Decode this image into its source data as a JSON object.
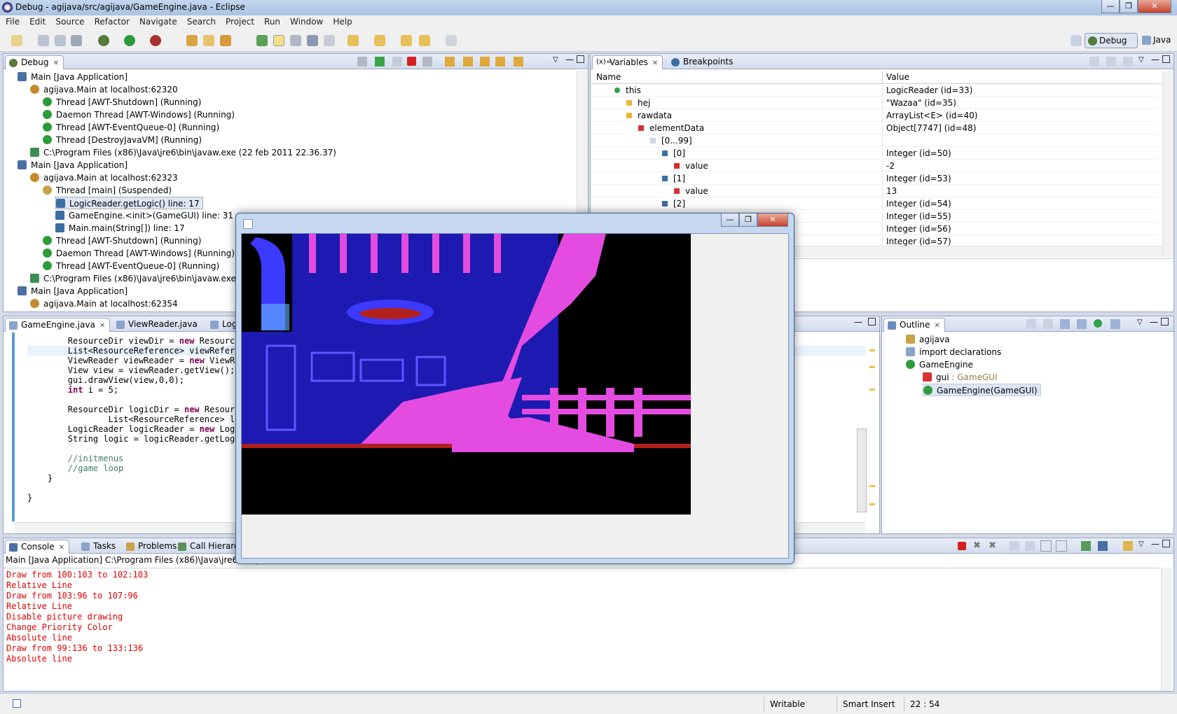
{
  "window": {
    "title": "Debug - agijava/src/agijava/GameEngine.java - Eclipse"
  },
  "menu": [
    "File",
    "Edit",
    "Source",
    "Refactor",
    "Navigate",
    "Search",
    "Project",
    "Run",
    "Window",
    "Help"
  ],
  "perspectives": {
    "debug": "Debug",
    "java": "Java"
  },
  "debug_view": {
    "tab": "Debug",
    "rows": [
      {
        "text": "Main [Java Application]",
        "indent": 0,
        "icon": "launch-icon"
      },
      {
        "text": "agijava.Main at localhost:62320",
        "indent": 1,
        "icon": "debug-target-icon"
      },
      {
        "text": "Thread [AWT-Shutdown] (Running)",
        "indent": 2,
        "icon": "thread-icon"
      },
      {
        "text": "Daemon Thread [AWT-Windows] (Running)",
        "indent": 2,
        "icon": "thread-icon"
      },
      {
        "text": "Thread [AWT-EventQueue-0] (Running)",
        "indent": 2,
        "icon": "thread-icon"
      },
      {
        "text": "Thread [DestroyJavaVM] (Running)",
        "indent": 2,
        "icon": "thread-icon"
      },
      {
        "text": "C:\\Program Files (x86)\\Java\\jre6\\bin\\javaw.exe (22 feb 2011 22.36.37)",
        "indent": 1,
        "icon": "process-icon"
      },
      {
        "text": "Main [Java Application]",
        "indent": 0,
        "icon": "launch-icon"
      },
      {
        "text": "agijava.Main at localhost:62323",
        "indent": 1,
        "icon": "debug-target-icon"
      },
      {
        "text": "Thread [main] (Suspended)",
        "indent": 2,
        "icon": "suspended-thread-icon"
      },
      {
        "text": "LogicReader.getLogic() line: 17",
        "indent": 3,
        "icon": "stack-frame-icon",
        "selected": true
      },
      {
        "text": "GameEngine.<init>(GameGUI) line: 31",
        "indent": 3,
        "icon": "stack-frame-icon"
      },
      {
        "text": "Main.main(String[]) line: 17",
        "indent": 3,
        "icon": "stack-frame-icon"
      },
      {
        "text": "Thread [AWT-Shutdown] (Running)",
        "indent": 2,
        "icon": "thread-icon"
      },
      {
        "text": "Daemon Thread [AWT-Windows] (Running)",
        "indent": 2,
        "icon": "thread-icon"
      },
      {
        "text": "Thread [AWT-EventQueue-0] (Running)",
        "indent": 2,
        "icon": "thread-icon"
      },
      {
        "text": "C:\\Program Files (x86)\\Java\\jre6\\bin\\javaw.exe (22",
        "indent": 1,
        "icon": "process-icon"
      },
      {
        "text": "Main [Java Application]",
        "indent": 0,
        "icon": "launch-icon"
      },
      {
        "text": "agijava.Main at localhost:62354",
        "indent": 1,
        "icon": "debug-target-icon"
      }
    ]
  },
  "variables_view": {
    "tabs": [
      "Variables",
      "Breakpoints"
    ],
    "columns": [
      "Name",
      "Value"
    ],
    "rows": [
      {
        "name": "this",
        "value": "LogicReader  (id=33)",
        "indent": 0
      },
      {
        "name": "hej",
        "value": "\"Wazaa\" (id=35)",
        "indent": 1
      },
      {
        "name": "rawdata",
        "value": "ArrayList<E>  (id=40)",
        "indent": 1
      },
      {
        "name": "elementData",
        "value": "Object[7747]  (id=48)",
        "indent": 2
      },
      {
        "name": "[0...99]",
        "value": "",
        "indent": 3
      },
      {
        "name": "[0]",
        "value": "Integer  (id=50)",
        "indent": 4
      },
      {
        "name": "value",
        "value": "-2",
        "indent": 5
      },
      {
        "name": "[1]",
        "value": "Integer  (id=53)",
        "indent": 4
      },
      {
        "name": "value",
        "value": "13",
        "indent": 5
      },
      {
        "name": "[2]",
        "value": "Integer  (id=54)",
        "indent": 4
      },
      {
        "name": "",
        "value": "Integer  (id=55)",
        "indent": 4
      },
      {
        "name": "",
        "value": "Integer  (id=56)",
        "indent": 4
      },
      {
        "name": "",
        "value": "Integer  (id=57)",
        "indent": 4
      }
    ]
  },
  "editor": {
    "tabs": [
      "GameEngine.java",
      "ViewReader.java",
      "Log"
    ],
    "lines": [
      "        ResourceDir viewDir = new ResourceD",
      "        List<ResourceReference> viewRefere",
      "        ViewReader viewReader = new ViewRea",
      "        View view = viewReader.getView();",
      "        gui.drawView(view,0,0);",
      "        int i = 5;",
      "",
      "        ResourceDir logicDir = new Resource",
      "                List<ResourceReference> log",
      "        LogicReader logicReader = new Logic",
      "        String logic = logicReader.getLogic",
      "",
      "        //initmenus",
      "        //game loop",
      "    }",
      "",
      "}"
    ]
  },
  "outline_view": {
    "tab": "Outline",
    "rows": [
      {
        "text": "agijava",
        "extra": "",
        "indent": 0,
        "icon": "package-icon"
      },
      {
        "text": "import declarations",
        "extra": "",
        "indent": 0,
        "icon": "imports-icon"
      },
      {
        "text": "GameEngine",
        "extra": "",
        "indent": 0,
        "icon": "class-icon"
      },
      {
        "text": "gui",
        "extra": " : GameGUI",
        "indent": 1,
        "icon": "field-icon"
      },
      {
        "text": "GameEngine(GameGUI)",
        "extra": "",
        "indent": 1,
        "icon": "constructor-icon",
        "selected": true
      }
    ]
  },
  "console_view": {
    "tabs": [
      "Console",
      "Tasks",
      "Problems",
      "Call Hierarch"
    ],
    "header": "Main [Java Application] C:\\Program Files (x86)\\Java\\jre6\\bin\\ja",
    "lines": [
      "Draw from 100:103 to 102:103",
      "Relative Line",
      "Draw from 103:96 to 107:96",
      "Relative Line",
      "Disable picture drawing",
      "Change Priority Color",
      "Absolute line",
      "Draw from 99:136 to 133:136",
      "Absolute line"
    ]
  },
  "status_bar": {
    "writable": "Writable",
    "insert_mode": "Smart Insert",
    "position": "22 : 54"
  },
  "colors": {
    "accent": "#3a6ea5",
    "console_text": "#e00000",
    "keyword": "#7f0055",
    "comment": "#3f7f5f"
  }
}
